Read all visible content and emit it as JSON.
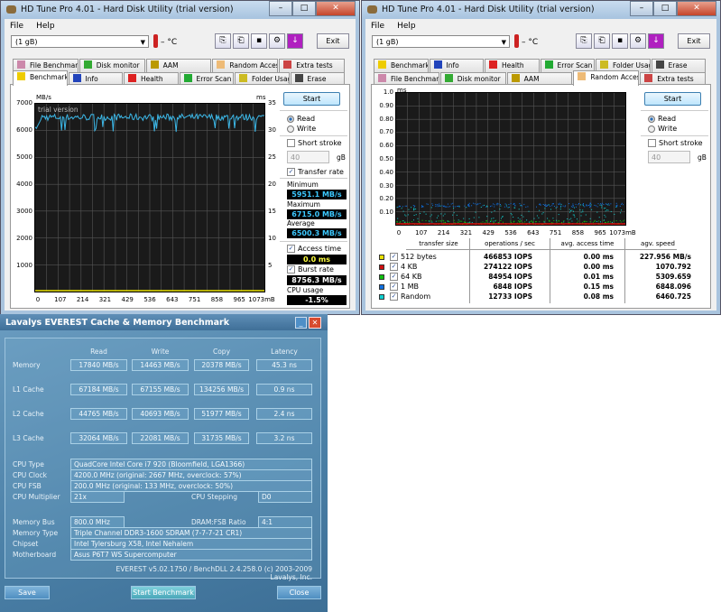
{
  "hdtune_benchmark": {
    "title": "HD Tune Pro 4.01 - Hard Disk Utility (trial version)",
    "menu": [
      "File",
      "Help"
    ],
    "drive": "(1 gB)",
    "temperature": "– °C",
    "exit": "Exit",
    "window_buttons": [
      "–",
      "□",
      "✕"
    ],
    "tabs_back": [
      {
        "label": "File Benchmark",
        "icon": "file-benchmark-icon",
        "color": "#c8a"
      },
      {
        "label": "Disk monitor",
        "icon": "disk-monitor-icon",
        "color": "#3a3"
      },
      {
        "label": "AAM",
        "icon": "speaker-icon",
        "color": "#b90"
      },
      {
        "label": "Random Access",
        "icon": "random-access-icon",
        "color": "#eb7"
      },
      {
        "label": "Extra tests",
        "icon": "extra-tests-icon",
        "color": "#c44"
      }
    ],
    "tabs_front": [
      {
        "label": "Benchmark",
        "icon": "benchmark-icon",
        "color": "#ec0"
      },
      {
        "label": "Info",
        "icon": "info-icon",
        "color": "#24b"
      },
      {
        "label": "Health",
        "icon": "health-icon",
        "color": "#d22"
      },
      {
        "label": "Error Scan",
        "icon": "error-scan-icon",
        "color": "#2a3"
      },
      {
        "label": "Folder Usage",
        "icon": "folder-icon",
        "color": "#cb2"
      },
      {
        "label": "Erase",
        "icon": "trash-icon",
        "color": "#444"
      }
    ],
    "active_tab": "Benchmark",
    "watermark": "trial version",
    "start": "Start",
    "read": "Read",
    "write": "Write",
    "short_stroke": "Short stroke",
    "stroke_value": "40",
    "stroke_unit": "gB",
    "transfer_rate": "Transfer rate",
    "minimum_label": "Minimum",
    "minimum": "5951.1 MB/s",
    "maximum_label": "Maximum",
    "maximum": "6715.0 MB/s",
    "average_label": "Average",
    "average": "6500.3 MB/s",
    "access_time_label": "Access time",
    "access_time": "0.0 ms",
    "burst_rate_label": "Burst rate",
    "burst_rate": "8756.3 MB/s",
    "cpu_label": "CPU usage",
    "cpu": "-1.5%",
    "colors": {
      "transfer": "#3cb8e8",
      "access": "#e8e000",
      "value_blue": "#3cc8ff",
      "value_yellow": "#ffff40"
    }
  },
  "hdtune_random": {
    "title": "HD Tune Pro 4.01 - Hard Disk Utility (trial version)",
    "menu": [
      "File",
      "Help"
    ],
    "drive": "(1 gB)",
    "temperature": "– °C",
    "exit": "Exit",
    "window_buttons": [
      "–",
      "□",
      "✕"
    ],
    "active_tab": "Random Access",
    "start": "Start",
    "read": "Read",
    "write": "Write",
    "short_stroke": "Short stroke",
    "stroke_value": "40",
    "stroke_unit": "gB",
    "table": {
      "headers": [
        "transfer size",
        "operations / sec",
        "avg. access time",
        "agv. speed"
      ],
      "rows": [
        {
          "size": "512 bytes",
          "ops": "466853 IOPS",
          "time": "0.00 ms",
          "speed": "227.956 MB/s",
          "color": "#e8e000"
        },
        {
          "size": "4 KB",
          "ops": "274122 IOPS",
          "time": "0.00 ms",
          "speed": "1070.792",
          "color": "#d01010"
        },
        {
          "size": "64 KB",
          "ops": "84954 IOPS",
          "time": "0.01 ms",
          "speed": "5309.659",
          "color": "#10c010"
        },
        {
          "size": "1 MB",
          "ops": "6848 IOPS",
          "time": "0.15 ms",
          "speed": "6848.096",
          "color": "#1070e0"
        },
        {
          "size": "Random",
          "ops": "12733 IOPS",
          "time": "0.08 ms",
          "speed": "6460.725",
          "color": "#10d0d0"
        }
      ]
    }
  },
  "chart_data": [
    {
      "type": "line",
      "title": "Benchmark transfer rate",
      "ylabel": "MB/s",
      "y2label": "ms",
      "xlabel": "mB",
      "ylim": [
        0,
        7000
      ],
      "y2lim": [
        0,
        35
      ],
      "yticks": [
        "7000",
        "6000",
        "5000",
        "4000",
        "3000",
        "2000",
        "1000"
      ],
      "y2ticks": [
        "35",
        "30",
        "25",
        "20",
        "15",
        "10",
        "5"
      ],
      "xticks": [
        "0",
        "107",
        "214",
        "321",
        "429",
        "536",
        "643",
        "751",
        "858",
        "965",
        "1073mB"
      ],
      "series": [
        {
          "name": "Transfer rate",
          "min": 5951.1,
          "max": 6715.0,
          "avg": 6500.3,
          "start": 6000
        },
        {
          "name": "Access time",
          "value": 0.0
        }
      ]
    },
    {
      "type": "scatter",
      "title": "Random Access",
      "ylabel": "ms",
      "ylim": [
        0,
        1.0
      ],
      "yticks": [
        "1.0",
        "0.90",
        "0.80",
        "0.70",
        "0.60",
        "0.50",
        "0.40",
        "0.30",
        "0.20",
        "0.10"
      ],
      "xticks": [
        "0",
        "107",
        "214",
        "321",
        "429",
        "536",
        "643",
        "751",
        "858",
        "965",
        "1073mB"
      ],
      "series": [
        {
          "name": "512 bytes",
          "avg_ms": 0.0
        },
        {
          "name": "4 KB",
          "avg_ms": 0.0
        },
        {
          "name": "64 KB",
          "avg_ms": 0.01
        },
        {
          "name": "1 MB",
          "avg_ms": 0.15
        },
        {
          "name": "Random",
          "avg_ms": 0.08
        }
      ]
    }
  ],
  "everest": {
    "title": "Lavalys EVEREST Cache & Memory Benchmark",
    "headers": [
      "Read",
      "Write",
      "Copy",
      "Latency"
    ],
    "rows": [
      {
        "label": "Memory",
        "values": [
          "17840 MB/s",
          "14463 MB/s",
          "20378 MB/s",
          "45.3 ns"
        ]
      },
      {
        "label": "L1 Cache",
        "values": [
          "67184 MB/s",
          "67155 MB/s",
          "134256 MB/s",
          "0.9 ns"
        ]
      },
      {
        "label": "L2 Cache",
        "values": [
          "44765 MB/s",
          "40693 MB/s",
          "51977 MB/s",
          "2.4 ns"
        ]
      },
      {
        "label": "L3 Cache",
        "values": [
          "32064 MB/s",
          "22081 MB/s",
          "31735 MB/s",
          "3.2 ns"
        ]
      }
    ],
    "cpu_type_label": "CPU Type",
    "cpu_type": "QuadCore Intel Core i7 920  (Bloomfield, LGA1366)",
    "cpu_clock_label": "CPU Clock",
    "cpu_clock": "4200.0 MHz  (original: 2667 MHz, overclock: 57%)",
    "cpu_fsb_label": "CPU FSB",
    "cpu_fsb": "200.0 MHz  (original: 133 MHz, overclock: 50%)",
    "cpu_mult_label": "CPU Multiplier",
    "cpu_mult": "21x",
    "cpu_stepping_label": "CPU Stepping",
    "cpu_stepping": "D0",
    "mem_bus_label": "Memory Bus",
    "mem_bus": "800.0 MHz",
    "dram_ratio_label": "DRAM:FSB Ratio",
    "dram_ratio": "4:1",
    "mem_type_label": "Memory Type",
    "mem_type": "Triple Channel DDR3-1600 SDRAM  (7-7-7-21 CR1)",
    "chipset_label": "Chipset",
    "chipset": "Intel Tylersburg X58, Intel Nehalem",
    "mobo_label": "Motherboard",
    "mobo": "Asus P6T7 WS Supercomputer",
    "footer": "EVEREST v5.02.1750 / BenchDLL 2.4.258.0  (c) 2003-2009 Lavalys, Inc.",
    "save": "Save",
    "start": "Start Benchmark",
    "close": "Close",
    "window_buttons": [
      "_",
      "✕"
    ]
  }
}
